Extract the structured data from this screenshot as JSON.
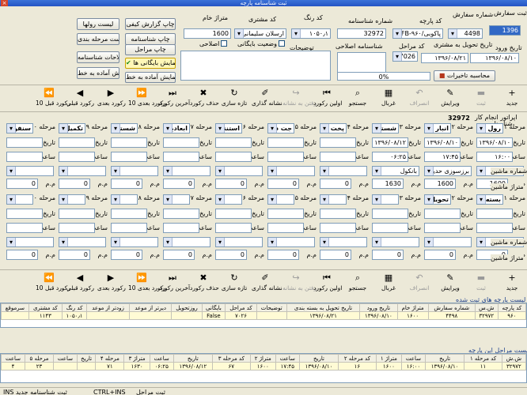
{
  "window": {
    "title": "ثبت شناسنامه پارچه",
    "close": "×"
  },
  "top": {
    "fields": {
      "sale_label": "سال ثبت سفارش",
      "sale_value": "1396",
      "order_num_label": "شماره سفارش",
      "order_num_value": "4498",
      "fabric_code_label": "کد پارچه",
      "fabric_code_value": "پاکوبی/LFB-۹۶۰",
      "id_num_label": "شماره شناسنامه",
      "id_num_value": "32972",
      "color_code_label": "کد رنگ",
      "color_code_value": "۱۰۵۰٫۱",
      "customer_code_label": "کد مشتری",
      "customer_code_value": "ارسلان سلیمانی",
      "meterage_label": "متراژ خام",
      "meterage_value": "1600",
      "entry_date_label": "تاریخ ورود",
      "entry_date_value": "۱۳۹۶/۰۸/۱۰",
      "delivery_date_label": "تاریخ تحویل به مشتری",
      "delivery_date_value": "۱۳۹۶/۰۸/۲۱",
      "stage_code_label": "کد مراحل",
      "stage_code_value": "7026",
      "correction_id_label": "شناسنامه اصلاحی",
      "notes_label": "توضیحات",
      "archive_status_label": "وضعیت بایگانی",
      "correction_label": "اصلاحی",
      "progress_text": "0%",
      "calc_delay_label": "محاسبه تاخیرات"
    },
    "buttons": {
      "roll_list": "لیست رولها",
      "print_report": "چاپ گزارش کیفی",
      "stage_list": "لیست مرحله بندی",
      "print_id": "چاپ شناسنامه",
      "print_stages": "چاپ مراحل",
      "correction_list": "اصلاحات شناسنامه",
      "show_archived": "نمایش بایگانی ها",
      "ready_report": "گزارش آماده به خط",
      "show_ready": "نمایش آماده به خط"
    }
  },
  "toolbar": {
    "items": [
      {
        "label": "جدید",
        "icon": "+"
      },
      {
        "label": "ثبت",
        "icon": "▬",
        "dim": true
      },
      {
        "label": "ویرایش",
        "icon": "✎"
      },
      {
        "label": "انصراف",
        "icon": "↶",
        "dim": true
      },
      {
        "label": "غربال",
        "icon": "▦"
      },
      {
        "label": "جستجو",
        "icon": "⌕"
      },
      {
        "label": "اولین رکورد",
        "icon": "⏮"
      },
      {
        "label": "رفتن به نشانه",
        "icon": "↪",
        "dim": true
      },
      {
        "label": "نشانه گذاری",
        "icon": "✐"
      },
      {
        "label": "تازه سازی",
        "icon": "↻"
      },
      {
        "label": "حذف رکورد",
        "icon": "✖"
      },
      {
        "label": "آخرین رکورد",
        "icon": "⏭"
      },
      {
        "label": "10 رکورد بعدی",
        "icon": "⏩"
      },
      {
        "label": "رکورد بعدی",
        "icon": "▶"
      },
      {
        "label": "رکورد قبلی",
        "icon": "◀"
      },
      {
        "label": "10 رکورد قبل",
        "icon": "⏪"
      }
    ]
  },
  "stages_header": {
    "operator_label": "اپراتور انجام کار",
    "id_label": "شناسنامه",
    "id_value": "32972"
  },
  "stages": [
    {
      "n": "مرحله ۱",
      "name": "رول پیچ",
      "date": "۱۳۹۶/۰۸/۱۰",
      "time": "۱۶:۰۰",
      "machine": "",
      "meter": "1600"
    },
    {
      "n": "مرحله ۲",
      "name": "انبار",
      "date": "۱۳۹۶/۰۸/۱۰",
      "time": "۱۷:۴۵",
      "machine": "برزسوزی حدید",
      "meter": "1600"
    },
    {
      "n": "مرحله ۳",
      "name": "شستشو",
      "date": "۱۳۹۶/۰۸/۱۲",
      "time": "۰۶:۲۵",
      "machine": "بانکول",
      "meter": "1630"
    },
    {
      "n": "مرحله ۴",
      "name": "پخت و",
      "date": "",
      "time": "",
      "machine": "",
      "meter": "0"
    },
    {
      "n": "مرحله ۵",
      "name": "جت در",
      "date": "",
      "time": "",
      "machine": "",
      "meter": "0"
    },
    {
      "n": "مرحله ۶",
      "name": "استنتر",
      "date": "",
      "time": "",
      "machine": "",
      "meter": "0"
    },
    {
      "n": "مرحله ۷",
      "name": "ابعادبگیر",
      "date": "",
      "time": "",
      "machine": "",
      "meter": "0"
    },
    {
      "n": "مرحله ۸",
      "name": "شستشو",
      "date": "",
      "time": "",
      "machine": "",
      "meter": "0"
    },
    {
      "n": "مرحله ۹",
      "name": "تکمیل با",
      "date": "",
      "time": "",
      "machine": "",
      "meter": "0"
    },
    {
      "n": "مرحله ۱۰",
      "name": "سنفور",
      "date": "",
      "time": "",
      "machine": "",
      "meter": "0"
    },
    {
      "n": "مرحله ۱۱",
      "name": "بسته",
      "date": "",
      "time": "",
      "machine": "",
      "meter": "0"
    },
    {
      "n": "مرحله ۱۲",
      "name": "تحویل",
      "date": "",
      "time": "",
      "machine": "",
      "meter": "0"
    },
    {
      "n": "مرحله ۱۳",
      "name": "",
      "date": "",
      "time": "",
      "machine": "",
      "meter": "0"
    },
    {
      "n": "مرحله ۱۴",
      "name": "",
      "date": "",
      "time": "",
      "machine": "",
      "meter": "0"
    },
    {
      "n": "مرحله ۱۵",
      "name": "",
      "date": "",
      "time": "",
      "machine": "",
      "meter": "0"
    },
    {
      "n": "مرحله ۱۶",
      "name": "",
      "date": "",
      "time": "",
      "machine": "",
      "meter": "0"
    },
    {
      "n": "مرحله ۱۷",
      "name": "",
      "date": "",
      "time": "",
      "machine": "",
      "meter": "0"
    },
    {
      "n": "مرحله ۱۸",
      "name": "",
      "date": "",
      "time": "",
      "machine": "",
      "meter": "0"
    },
    {
      "n": "مرحله ۱۹",
      "name": "",
      "date": "",
      "time": "",
      "machine": "",
      "meter": "0"
    },
    {
      "n": "مرحله ۲۰",
      "name": "",
      "date": "",
      "time": "",
      "machine": "",
      "meter": "0"
    }
  ],
  "row_labels": {
    "date": "تاریخ",
    "time": "ساعت",
    "machine": "شماره ماشین",
    "meterage": "متراژ ماشین",
    "unit": "م.م"
  },
  "table1": {
    "title": "لیست پارچه های ثبت شده",
    "headers": [
      "کد پارچه",
      "ش.س",
      "شماره سفارش",
      "متراژ خام",
      "تاریخ ورود",
      "تاریخ تحویل به بسته بندی",
      "توضیحات",
      "کد مراحل",
      "بایگانی",
      "روزتحویل",
      "دیرتر از موعد",
      "زودتر از موعد",
      "کد رنگ",
      "کد مشتری",
      "سرموقع"
    ],
    "rows": [
      [
        "۹۶۰",
        "۳۲۹۷۲",
        "۴۴۹۸",
        "۱۶۰۰",
        "۱۳۹۶/۰۸/۱۰",
        "۱۳۹۶/۰۸/۲۱",
        "",
        "۷۰۲۶",
        "False",
        "",
        "",
        "",
        "۱۰۵۰٫۱",
        "۱۱۴۳",
        ""
      ]
    ]
  },
  "table2": {
    "title": "لیست مراحل این پارچه",
    "headers": [
      "ش.ش",
      "کد مرحله ۱",
      "تاریخ",
      "ساعت",
      "متراژ ۱",
      "کد مرحله ۲",
      "تاریخ",
      "ساعت",
      "متراژ ۲",
      "کد مرحله ۳",
      "تاریخ",
      "ساعت",
      "متراژ ۳",
      "مرحله ۴",
      "تاریخ",
      "ساعت",
      "مرحله ۵",
      "ساعت"
    ],
    "rows": [
      [
        "۳۲۹۷۲",
        "۱۱",
        "۱۳۹۶/۰۸/۱۰",
        "۱۶:۰۰",
        "۱۶۰۰",
        "۱۶",
        "۱۳۹۶/۰۸/۱۰",
        "۱۷:۴۵",
        "۱۶۰۰",
        "۶۷",
        "۱۳۹۶/۰۸/۱۲",
        "۰۶:۲۵",
        "۱۶۳۰",
        "۷۱",
        "",
        "",
        "۲۳",
        "۴"
      ]
    ]
  },
  "status": {
    "items": [
      "ثبت مراحل",
      "CTRL+INS",
      "ثبت شناسنامه جدید INS"
    ]
  }
}
